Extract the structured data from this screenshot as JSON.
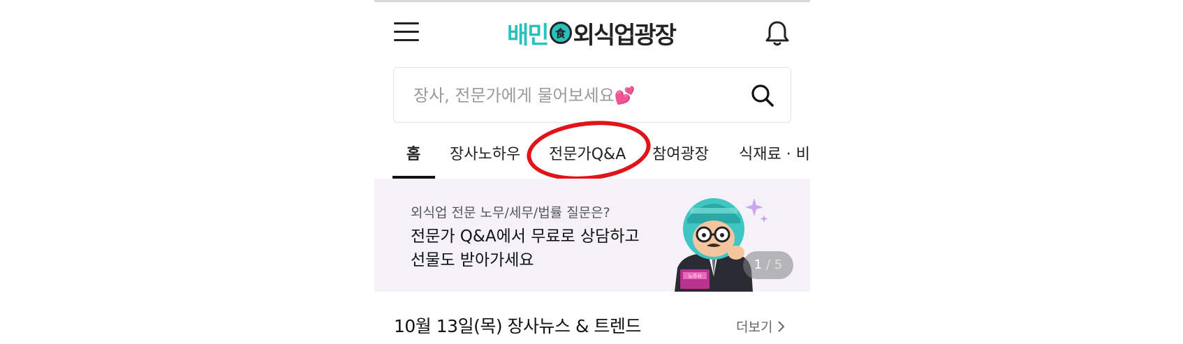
{
  "header": {
    "logo_brand": "배민",
    "logo_mark": "食",
    "logo_name": "외식업광장"
  },
  "search": {
    "placeholder": "장사, 전문가에게 물어보세요💕"
  },
  "tabs": [
    {
      "label": "홈",
      "active": true
    },
    {
      "label": "장사노하우",
      "active": false
    },
    {
      "label": "전문가Q&A",
      "active": false
    },
    {
      "label": "참여광장",
      "active": false
    },
    {
      "label": "식재료 · 비",
      "active": false
    }
  ],
  "banner": {
    "subtitle": "외식업 전문 노무/세무/법률 질문은?",
    "title_line1": "전문가 Q&A에서 무료로 상담하고",
    "title_line2": "선물도 받아가세요",
    "badge": "노무사",
    "page_current": "1",
    "page_total": "/ 5"
  },
  "news": {
    "title": "10월 13일(목) 장사뉴스 & 트렌드",
    "more_label": "더보기"
  },
  "colors": {
    "brand": "#2ac1bc",
    "annotation": "#e3131a",
    "banner_bg": "#f4f2f8"
  }
}
